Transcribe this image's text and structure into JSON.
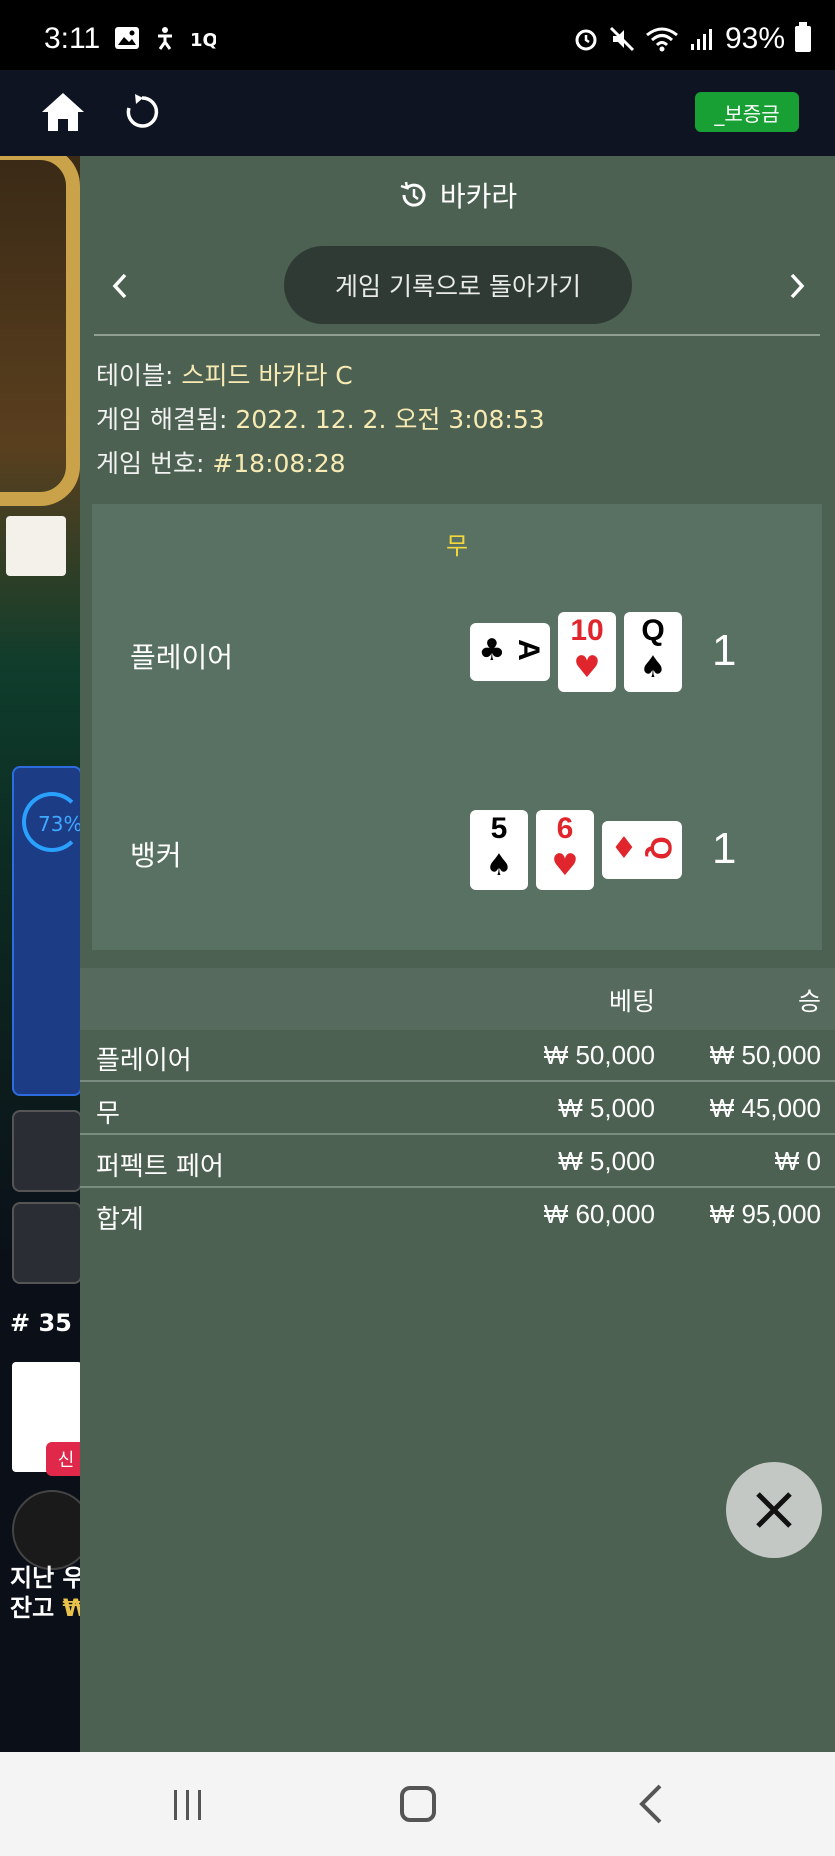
{
  "status_bar": {
    "time": "3:11",
    "battery": "93%",
    "left_icons": [
      "gallery-icon",
      "accessibility-icon",
      "sim-icon"
    ],
    "right_icons": [
      "alarm-icon",
      "mute-icon",
      "wifi-icon",
      "signal-icon",
      "battery-icon"
    ]
  },
  "app_bar": {
    "deposit_label": "_보증금"
  },
  "background_game": {
    "progress": "73%",
    "round": "# 35",
    "new_tag": "신",
    "last_win_label": "지난 우승",
    "balance_label": "잔고",
    "balance_currency": "₩"
  },
  "overlay": {
    "title": "바카라",
    "back_label": "게임 기록으로 돌아가기",
    "table_label": "테이블:",
    "table_value": "스피드 바카라 C",
    "resolved_label": "게임 해결됨:",
    "resolved_value": "2022. 12. 2. 오전 3:08:53",
    "game_no_label": "게임 번호:",
    "game_no_value": "#18:08:28",
    "result": "무",
    "player": {
      "label": "플레이어",
      "score": "1",
      "cards": [
        {
          "rank": "A",
          "suit": "♣",
          "red": false,
          "orientation": "h"
        },
        {
          "rank": "10",
          "suit": "♥",
          "red": true,
          "orientation": "v"
        },
        {
          "rank": "Q",
          "suit": "♠",
          "red": false,
          "orientation": "v"
        }
      ]
    },
    "banker": {
      "label": "뱅커",
      "score": "1",
      "cards": [
        {
          "rank": "5",
          "suit": "♠",
          "red": false,
          "orientation": "v"
        },
        {
          "rank": "6",
          "suit": "♥",
          "red": true,
          "orientation": "v"
        },
        {
          "rank": "Q",
          "suit": "♦",
          "red": true,
          "orientation": "h"
        }
      ]
    },
    "bets_header": {
      "bet": "베팅",
      "win": "승"
    },
    "bets": [
      {
        "name": "플레이어",
        "bet": "₩ 50,000",
        "win": "₩ 50,000"
      },
      {
        "name": "무",
        "bet": "₩ 5,000",
        "win": "₩ 45,000"
      },
      {
        "name": "퍼펙트 페어",
        "bet": "₩ 5,000",
        "win": "₩ 0"
      }
    ],
    "total": {
      "name": "합계",
      "bet": "₩ 60,000",
      "win": "₩ 95,000"
    }
  },
  "colors": {
    "overlay_bg": "#4c6152",
    "result_yellow": "#f2d83c",
    "deposit_green": "#18a034",
    "info_value": "#f7eab2"
  }
}
